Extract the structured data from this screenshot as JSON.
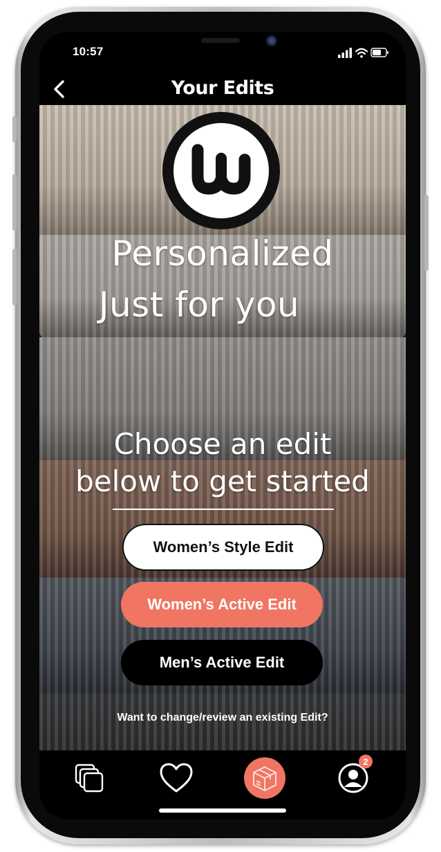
{
  "status_bar": {
    "time": "10:57"
  },
  "nav": {
    "title": "Your Edits"
  },
  "hero": {
    "headline_line1": "Personalized",
    "headline_line2": "Just for you",
    "sub_line1": "Choose an edit",
    "sub_line2": "below to get started"
  },
  "buttons": {
    "womens_style": "Women’s Style Edit",
    "womens_active": "Women’s Active Edit",
    "mens_active": "Men’s Active Edit"
  },
  "change_link": "Want to change/review an existing Edit?",
  "tab_bar": {
    "tabs": [
      {
        "icon": "stacked-cards-icon"
      },
      {
        "icon": "heart-icon"
      },
      {
        "icon": "box-icon"
      },
      {
        "icon": "profile-icon",
        "badge": "2"
      }
    ]
  },
  "colors": {
    "accent": "#f07563",
    "background": "#000000",
    "text": "#ffffff"
  }
}
